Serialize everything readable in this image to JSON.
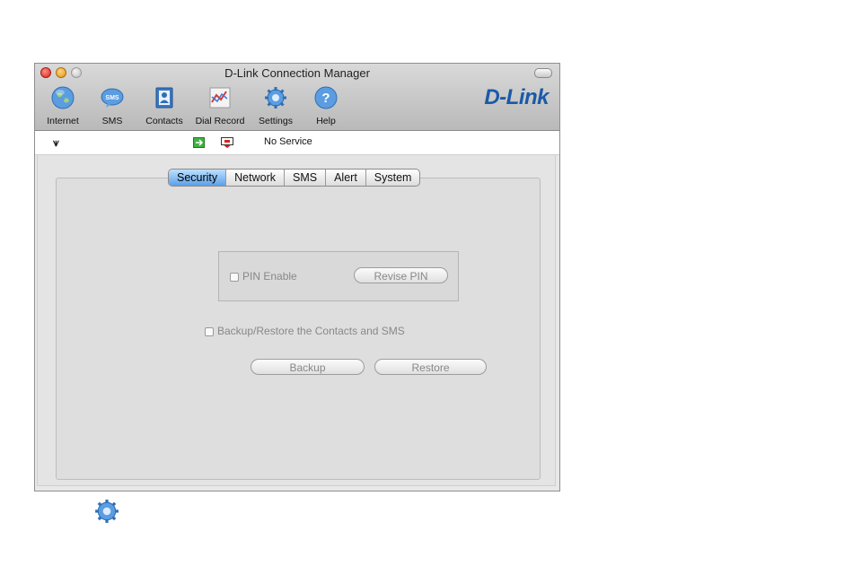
{
  "window": {
    "title": "D-Link Connection Manager",
    "brand": "D-Link"
  },
  "toolbar": {
    "items": [
      {
        "label": "Internet",
        "icon": "globe-icon"
      },
      {
        "label": "SMS",
        "icon": "sms-icon"
      },
      {
        "label": "Contacts",
        "icon": "contacts-book-icon"
      },
      {
        "label": "Dial Record",
        "icon": "dial-record-icon"
      },
      {
        "label": "Settings",
        "icon": "gear-icon"
      },
      {
        "label": "Help",
        "icon": "help-icon"
      }
    ]
  },
  "status": {
    "text": "No Service"
  },
  "tabs": [
    {
      "label": "Security",
      "active": true
    },
    {
      "label": "Network"
    },
    {
      "label": "SMS"
    },
    {
      "label": "Alert"
    },
    {
      "label": "System"
    }
  ],
  "security": {
    "pin_enable_label": "PIN Enable",
    "revise_pin_label": "Revise PIN",
    "backup_restore_label": "Backup/Restore the Contacts and SMS",
    "backup_label": "Backup",
    "restore_label": "Restore"
  },
  "colors": {
    "brand": "#1a5aa8",
    "active_tab": "#5aa1e8"
  }
}
